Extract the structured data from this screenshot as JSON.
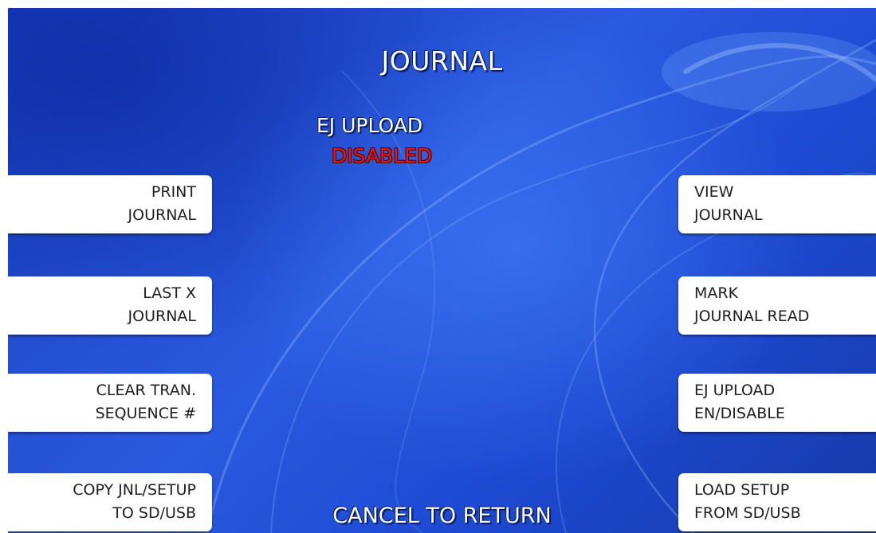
{
  "screen": {
    "title": "JOURNAL",
    "status_label": "EJ UPLOAD",
    "status_value": "DISABLED",
    "footer": "CANCEL TO RETURN",
    "colors": {
      "background": "#2a5ae0",
      "status_disabled": "#e01818",
      "button": "#ffffff"
    }
  },
  "left_buttons": [
    {
      "line1": "PRINT",
      "line2": "JOURNAL"
    },
    {
      "line1": "LAST X",
      "line2": "JOURNAL"
    },
    {
      "line1": "CLEAR TRAN.",
      "line2": "SEQUENCE #"
    },
    {
      "line1": "COPY JNL/SETUP",
      "line2": "TO SD/USB"
    }
  ],
  "right_buttons": [
    {
      "line1": "VIEW",
      "line2": "JOURNAL"
    },
    {
      "line1": "MARK",
      "line2": "JOURNAL READ"
    },
    {
      "line1": "EJ UPLOAD",
      "line2": "EN/DISABLE"
    },
    {
      "line1": "LOAD SETUP",
      "line2": "FROM SD/USB"
    }
  ]
}
